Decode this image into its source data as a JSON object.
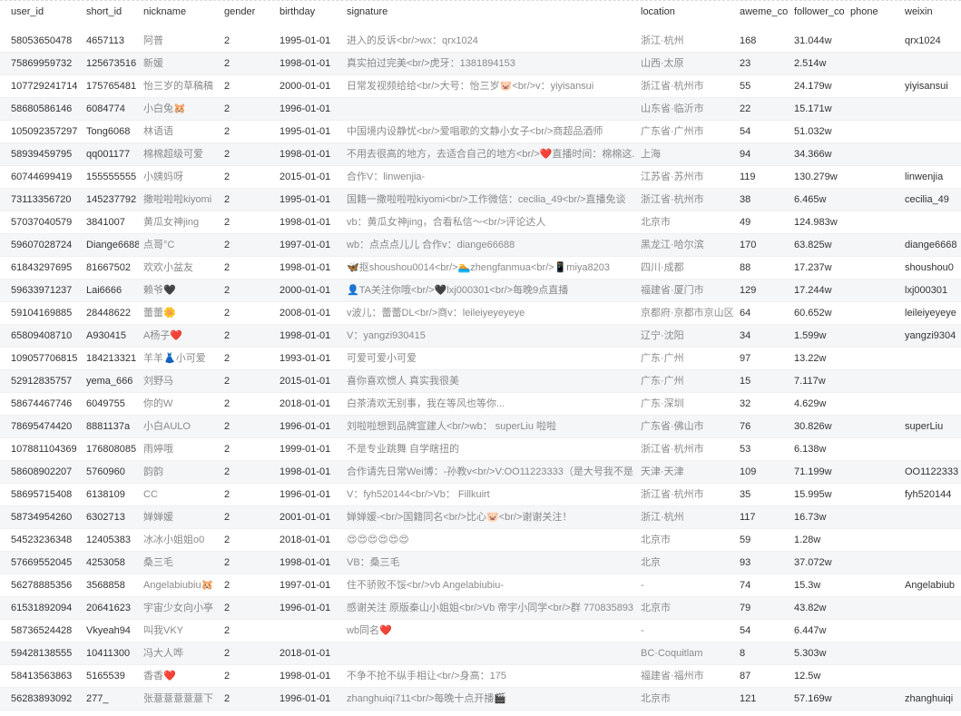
{
  "columns": [
    "user_id",
    "short_id",
    "nickname",
    "gender",
    "birthday",
    "signature",
    "location",
    "aweme_co",
    "follower_co",
    "phone",
    "weixin"
  ],
  "rows": [
    [
      "58053650478",
      "4657113",
      "阿普",
      "2",
      "1995-01-01",
      "进入的反诉<br/>wx：qrx1024",
      "浙江·杭州",
      "168",
      "31.044w",
      "",
      "qrx1024"
    ],
    [
      "75869959732",
      "125673516",
      "新媛",
      "2",
      "1998-01-01",
      "真实拍过完美<br/>虎牙：1381894153",
      "山西·太原",
      "23",
      "2.514w",
      "",
      ""
    ],
    [
      "107729241714",
      "175765481",
      "怡三岁的草稿稿",
      "2",
      "2000-01-01",
      "日常发视频给给<br/>大号：怡三岁🐷<br/>v：yiyisansui",
      "浙江省·杭州市",
      "55",
      "24.179w",
      "",
      "yiyisansui"
    ],
    [
      "58680586146",
      "6084774",
      "小白兔🐹",
      "2",
      "1996-01-01",
      "",
      "山东省·临沂市",
      "22",
      "15.171w",
      "",
      ""
    ],
    [
      "105092357297",
      "Tong6068",
      "林语语",
      "2",
      "1995-01-01",
      "中国境内设静忧<br/>爱唱歌的文静小女子<br/>商超品酒师",
      "广东省·广州市",
      "54",
      "51.032w",
      "",
      ""
    ],
    [
      "58939459795",
      "qq001177",
      "棉棉超级可爱",
      "2",
      "1998-01-01",
      "不用去很高的地方，去适合自己的地方<br/>❤️直播时间：棉棉这...",
      "上海",
      "94",
      "34.366w",
      "",
      ""
    ],
    [
      "60744699419",
      "155555555",
      "小姨妈呀",
      "2",
      "2015-01-01",
      "合作V：linwenjia-",
      "江苏省·苏州市",
      "119",
      "130.279w",
      "",
      "linwenjia"
    ],
    [
      "73113356720",
      "145237792",
      "撒啦啦啦kiyomi",
      "2",
      "1995-01-01",
      "国籍一撒啦啦啦kiyomi<br/>工作微信：cecilia_49<br/>直播免谈",
      "浙江省·杭州市",
      "38",
      "6.465w",
      "",
      "cecilia_49"
    ],
    [
      "57037040579",
      "3841007",
      "黄瓜女神jing",
      "2",
      "1998-01-01",
      "vb：黄瓜女神jing，合看私信～<br/>评论达人",
      "北京市",
      "49",
      "124.983w",
      "",
      ""
    ],
    [
      "59607028724",
      "Diange6688",
      "点哥°C",
      "2",
      "1997-01-01",
      "wb：点点点儿儿 合作v：diange66688",
      "黑龙江·哈尔滨",
      "170",
      "63.825w",
      "",
      "diange6668"
    ],
    [
      "61843297695",
      "81667502",
      "欢欢小盆友",
      "2",
      "1998-01-01",
      "🦋抠shoushou0014<br/>🏊zhengfanmua<br/>📱miya8203",
      "四川·成都",
      "88",
      "17.237w",
      "",
      "shoushou0"
    ],
    [
      "59633971237",
      "Lai6666",
      "赖爷🖤",
      "2",
      "2000-01-01",
      "👤TA关注你哦<br/>🖤lxj000301<br/>每晚9点直播",
      "福建省·厦门市",
      "129",
      "17.244w",
      "",
      "lxj000301"
    ],
    [
      "59104169885",
      "28448622",
      "蕾蕾🌼",
      "2",
      "2008-01-01",
      "v波儿：蕾蕾DL<br/>商v：leileiyeyeyeye",
      "京都府·京都市京山区",
      "64",
      "60.652w",
      "",
      "leileiyeyeye"
    ],
    [
      "65809408710",
      "A930415",
      "A杨子❤️",
      "2",
      "1998-01-01",
      "V：yangzi930415",
      "辽宁·沈阳",
      "34",
      "1.599w",
      "",
      "yangzi9304"
    ],
    [
      "109057706815",
      "184213321",
      "羊羊👗小可爱",
      "2",
      "1993-01-01",
      "可爱可爱小可爱",
      "广东·广州",
      "97",
      "13.22w",
      "",
      ""
    ],
    [
      "52912835757",
      "yema_666",
      "刘野马",
      "2",
      "2015-01-01",
      "喜你喜欢惯人 真实我很美",
      "广东·广州",
      "15",
      "7.117w",
      "",
      ""
    ],
    [
      "58674467746",
      "6049755",
      "你的W",
      "2",
      "2018-01-01",
      "白茶清欢无别事，我在等风也等你...",
      "广东·深圳",
      "32",
      "4.629w",
      "",
      ""
    ],
    [
      "78695474420",
      "8881137a",
      "小白AULO",
      "2",
      "1996-01-01",
      "刘啦啦想到品牌宣建人<br/>wb： superLiu 啦啦",
      "广东省·佛山市",
      "76",
      "30.826w",
      "",
      "superLiu"
    ],
    [
      "107881104369",
      "176808085",
      "雨婷哦",
      "2",
      "1999-01-01",
      "不是专业跳舞 自学瞎扭的",
      "浙江省·杭州市",
      "53",
      "6.138w",
      "",
      ""
    ],
    [
      "58608902207",
      "5760960",
      "韵韵",
      "2",
      "1998-01-01",
      "合作请先日常Wei博：-孙教v<br/>V:OO11223333（是大号我不是...",
      "天津·天津",
      "109",
      "71.199w",
      "",
      "OO1122333"
    ],
    [
      "58695715408",
      "6138109",
      "CC",
      "2",
      "1996-01-01",
      "V：fyh520144<br/>Vb： Fillkuirt",
      "浙江省·杭州市",
      "35",
      "15.995w",
      "",
      "fyh520144"
    ],
    [
      "58734954260",
      "6302713",
      "婵婵媛",
      "2",
      "2001-01-01",
      "婵婵媛-<br/>国籍同名<br/>比心🐷<br/>谢谢关注！",
      "浙江·杭州",
      "117",
      "16.73w",
      "",
      ""
    ],
    [
      "54523236348",
      "12405383",
      "冰冰小姐姐o0",
      "2",
      "2018-01-01",
      "😍😍😍😍😍😍",
      "北京市",
      "59",
      "1.28w",
      "",
      ""
    ],
    [
      "57669552045",
      "4253058",
      "桑三毛",
      "2",
      "1998-01-01",
      "VB：桑三毛",
      "北京",
      "93",
      "37.072w",
      "",
      ""
    ],
    [
      "56278885356",
      "3568858",
      "Angelabiubiu🐹",
      "2",
      "1997-01-01",
      "住不骄败不馁<br/>vb Angelabiubiu-",
      "-",
      "74",
      "15.3w",
      "",
      "Angelabiub"
    ],
    [
      "61531892094",
      "20641623",
      "宇宙少女向小亭",
      "2",
      "1996-01-01",
      "感谢关注 原版秦山小姐姐<br/>Vb 帝宇小同学<br/>群 770835893",
      "北京市",
      "79",
      "43.82w",
      "",
      ""
    ],
    [
      "58736524428",
      "Vkyeah94",
      "叫我VKY",
      "2",
      "",
      "wb同名❤️",
      "-",
      "54",
      "6.447w",
      "",
      ""
    ],
    [
      "59428138555",
      "10411300",
      "冯大人哗",
      "2",
      "2018-01-01",
      "",
      "BC·Coquitlam",
      "8",
      "5.303w",
      "",
      ""
    ],
    [
      "58413563863",
      "5165539",
      "香香❤️",
      "2",
      "1998-01-01",
      "不争不抢不纵手相让<br/>身高：175",
      "福建省·福州市",
      "87",
      "12.5w",
      "",
      ""
    ],
    [
      "56283893092",
      "277_",
      "张薏薏薏薏薏下",
      "2",
      "1996-01-01",
      "zhanghuiqi711<br/>每晚十点开播🎬",
      "北京市",
      "121",
      "57.169w",
      "",
      "zhanghuiqi"
    ]
  ]
}
